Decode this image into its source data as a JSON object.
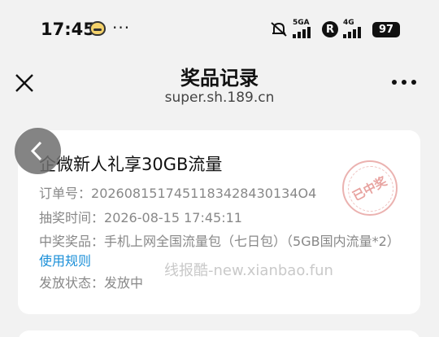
{
  "status_bar": {
    "time": "17:45",
    "dots": "···",
    "net1": "5GA",
    "r_label": "R",
    "net2": "4G",
    "battery": "97"
  },
  "header": {
    "title": "奖品记录",
    "url": "super.sh.189.cn"
  },
  "card": {
    "title": "企微新人礼享30GB流量",
    "order_label": "订单号：",
    "order_value": "2026081517451183428430134O4",
    "draw_time_label": "抽奖时间：",
    "draw_time_value": "2026-08-15 17:45:11",
    "prize_label": "中奖奖品：",
    "prize_value": "手机上网全国流量包（七日包）（5GB国内流量*2）",
    "rules_link": "使用规则",
    "status_label": "发放状态：",
    "status_value": "发放中",
    "stamp_text": "已中奖"
  },
  "watermark": "线报酷-new.xianbao.fun",
  "colors": {
    "background": "#f2f2f2",
    "card": "#ffffff",
    "link": "#1a8fd8",
    "stamp": "#e8a3a0"
  },
  "icons": {
    "close": "close-icon",
    "more": "more-icon",
    "back": "chevron-left-icon",
    "mute": "bell-off-icon"
  }
}
